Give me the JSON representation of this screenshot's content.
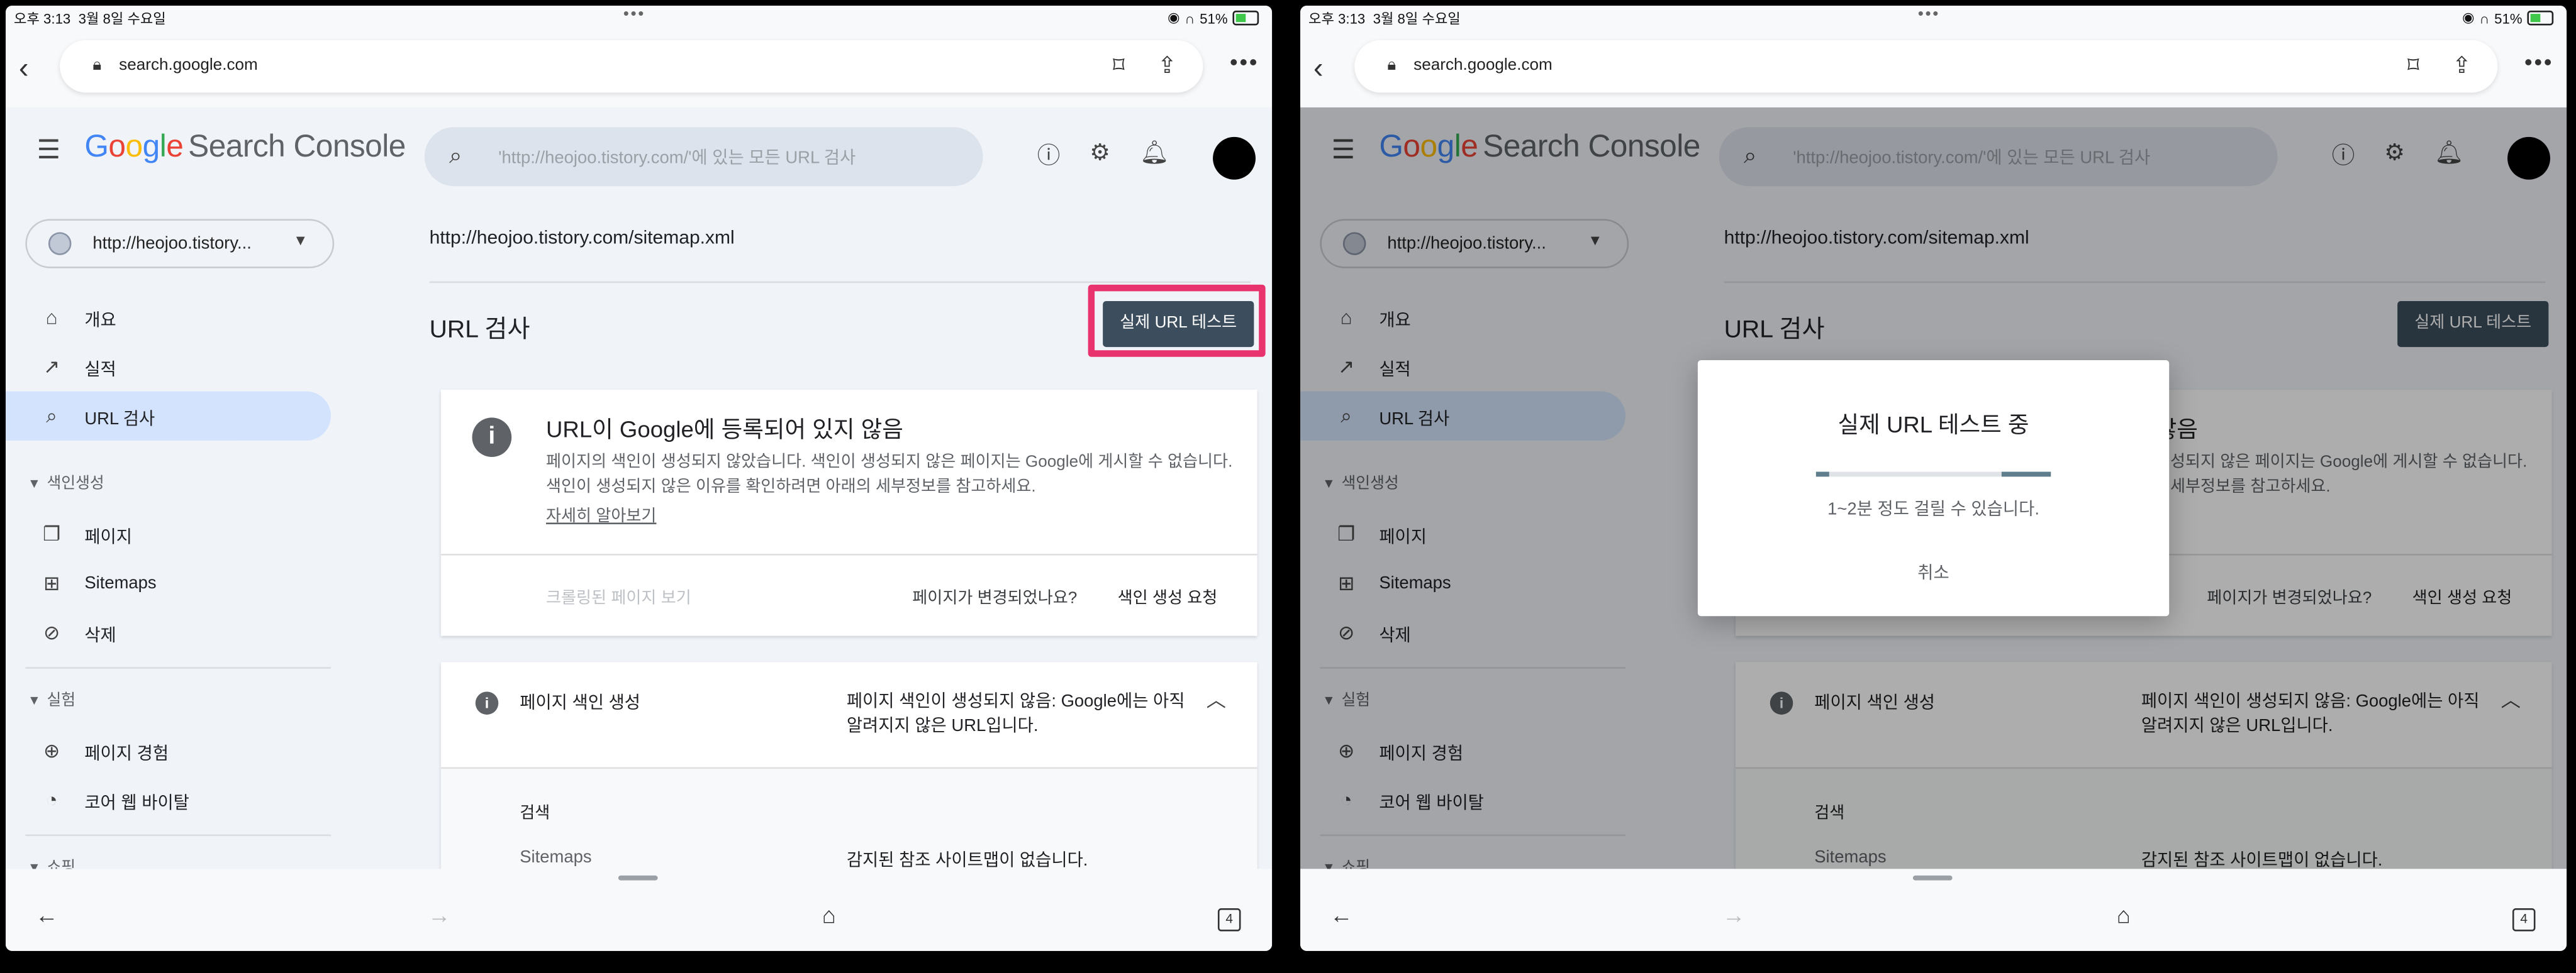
{
  "status": {
    "time": "오후 3:13",
    "date": "3월 8일 수요일",
    "battery": "51%"
  },
  "browser": {
    "url": "search.google.com"
  },
  "header": {
    "logo": [
      "G",
      "o",
      "o",
      "g",
      "l",
      "e"
    ],
    "product": "Search Console",
    "search_placeholder": "'http://heojoo.tistory.com/'에 있는 모든 URL 검사"
  },
  "sidebar": {
    "property": "http://heojoo.tistory...",
    "items": [
      {
        "label": "개요",
        "icon": "home-icon"
      },
      {
        "label": "실적",
        "icon": "trending-icon"
      },
      {
        "label": "URL 검사",
        "icon": "search-icon"
      },
      {
        "label": "페이지",
        "icon": "pages-icon"
      },
      {
        "label": "Sitemaps",
        "icon": "sitemap-icon"
      },
      {
        "label": "삭제",
        "icon": "eye-off-icon"
      },
      {
        "label": "페이지 경험",
        "icon": "plus-circle-icon"
      },
      {
        "label": "코어 웹 바이탈",
        "icon": "gauge-icon"
      }
    ],
    "sections": [
      "색인생성",
      "실험",
      "쇼핑"
    ]
  },
  "main": {
    "page_url": "http://heojoo.tistory.com/sitemap.xml",
    "title": "URL 검사",
    "live_test_button": "실제 URL 테스트",
    "status_card": {
      "heading": "URL이 Google에 등록되어 있지 않음",
      "description": "페이지의 색인이 생성되지 않았습니다. 색인이 생성되지 않은 페이지는 Google에 게시할 수 없습니다. 색인이 생성되지 않은 이유를 확인하려면 아래의 세부정보를 참고하세요.",
      "learn_more": "자세히 알아보기",
      "crawled_page": "크롤링된 페이지 보기",
      "page_changed": "페이지가 변경되었나요?",
      "request_indexing": "색인 생성 요청"
    },
    "index_card": {
      "heading": "페이지 색인 생성",
      "value": "페이지 색인이 생성되지 않음: Google에는 아직 알려지지 않은 URL입니다.",
      "sub_heading": "검색",
      "sitemaps_key": "Sitemaps",
      "sitemaps_value": "감지된 참조 사이트맵이 없습니다."
    }
  },
  "dialog": {
    "title": "실제 URL 테스트 중",
    "progress_fraction": 0.25,
    "description": "1~2분 정도 걸릴 수 있습니다.",
    "cancel": "취소"
  },
  "bottom": {
    "tabs_count": "4"
  },
  "colors": {
    "highlight": "#e8336e",
    "button": "#3c4e5e",
    "active_nav": "#d3e3fd"
  }
}
